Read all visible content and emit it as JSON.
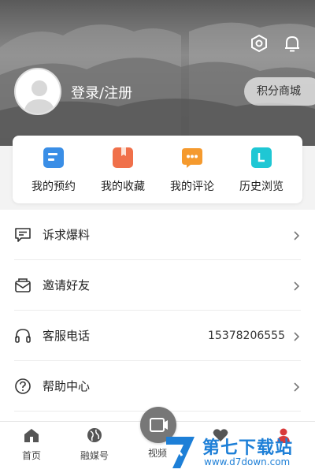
{
  "header": {
    "login_label": "登录/注册",
    "points_mall": "积分商城",
    "icons": [
      "settings-icon",
      "bell-icon"
    ]
  },
  "quick_actions": [
    {
      "label": "我的预约",
      "icon": "reservation-icon",
      "color": "#3a8ee6"
    },
    {
      "label": "我的收藏",
      "icon": "bookmark-icon",
      "color": "#f0704a"
    },
    {
      "label": "我的评论",
      "icon": "comment-icon",
      "color": "#f59a2e"
    },
    {
      "label": "历史浏览",
      "icon": "history-icon",
      "color": "#1fc7d4"
    }
  ],
  "menu": [
    {
      "label": "诉求爆料",
      "icon": "report-icon",
      "value": ""
    },
    {
      "label": "邀请好友",
      "icon": "invite-icon",
      "value": ""
    },
    {
      "label": "客服电话",
      "icon": "headset-icon",
      "value": "15378206555"
    },
    {
      "label": "帮助中心",
      "icon": "help-icon",
      "value": ""
    }
  ],
  "bottom_nav": [
    {
      "label": "首页",
      "icon": "home-icon"
    },
    {
      "label": "融媒号",
      "icon": "globe-icon"
    },
    {
      "label": "视频",
      "icon": "video-icon"
    },
    {
      "label": "",
      "icon": "heart-icon"
    },
    {
      "label": "",
      "icon": "profile-icon"
    }
  ],
  "watermark": {
    "brand": "第七下载站",
    "url": "www.d7down.com"
  },
  "colors": {
    "accent_blue": "#3a8ee6",
    "watermark_blue": "#1d7fd7"
  }
}
